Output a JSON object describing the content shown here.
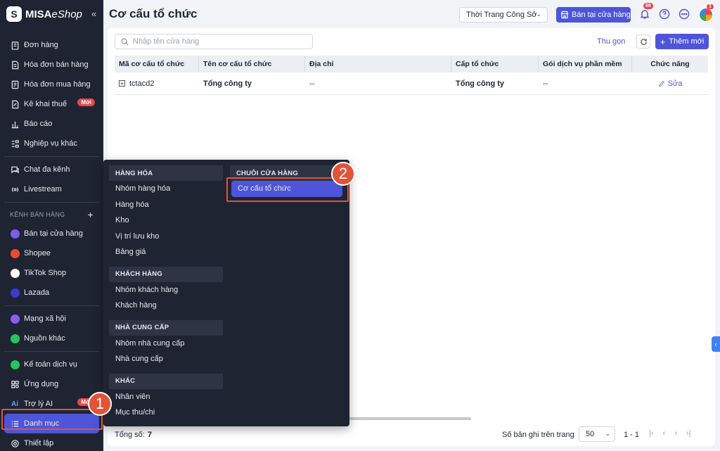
{
  "app": {
    "brand_main": "MISA",
    "brand_sub": "eShop",
    "collapse_glyph": "«"
  },
  "sidebar": {
    "items": [
      {
        "label": "Đơn hàng",
        "icon": "clipboard-icon"
      },
      {
        "label": "Hóa đơn bán hàng",
        "icon": "invoice-icon"
      },
      {
        "label": "Hóa đơn mua hàng",
        "icon": "purchase-invoice-icon"
      },
      {
        "label": "Kê khai thuế",
        "icon": "tax-icon",
        "badge": "Mới"
      },
      {
        "label": "Báo cáo",
        "icon": "chart-icon"
      },
      {
        "label": "Nghiệp vụ khác",
        "icon": "list-settings-icon"
      }
    ],
    "items2": [
      {
        "label": "Chat đa kênh",
        "icon": "chat-icon"
      },
      {
        "label": "Livestream",
        "icon": "live-icon"
      }
    ],
    "channels_title": "KÊNH BÁN HÀNG",
    "channels": [
      {
        "label": "Bán tại cửa hàng",
        "color": "#7c5cf0"
      },
      {
        "label": "Shopee",
        "color": "#ee4d2d"
      },
      {
        "label": "TikTok Shop",
        "color": "#ffffff"
      },
      {
        "label": "Lazada",
        "color": "#3b3bd1"
      }
    ],
    "items3": [
      {
        "label": "Mạng xã hội",
        "color": "#8b5cf6"
      },
      {
        "label": "Nguồn khác",
        "color": "#22c55e"
      }
    ],
    "items4": [
      {
        "label": "Kế toán dịch vụ",
        "color": "#22c55e"
      },
      {
        "label": "Ứng dụng",
        "icon": "apps-icon"
      },
      {
        "label": "Trợ lý AI",
        "icon": "ai-icon",
        "badge": "Mới"
      },
      {
        "label": "Danh mục",
        "icon": "list-icon",
        "active": true
      },
      {
        "label": "Thiết lập",
        "icon": "gear-icon"
      }
    ]
  },
  "header": {
    "title": "Cơ cấu tổ chức",
    "store": "Thời Trang Công Sở",
    "sell_button": "Bán tại cửa hàng",
    "notif_count": "69",
    "avatar_badge": "1"
  },
  "toolbar": {
    "search_placeholder": "Nhập tên cửa hàng",
    "collapse_label": "Thu gọn",
    "add_label": "Thêm mới"
  },
  "table": {
    "columns": [
      "Mã cơ cấu tổ chức",
      "Tên cơ cấu tổ chức",
      "Địa chỉ",
      "Cấp tổ chức",
      "Gói dịch vụ phần mềm",
      "Chức năng"
    ],
    "rows": [
      {
        "code": "tctacd2",
        "name": "Tổng công ty",
        "address": "--",
        "level": "Tổng công ty",
        "package": "--",
        "action": "Sửa"
      }
    ]
  },
  "footer": {
    "total_label": "Tổng số:",
    "total_value": "7",
    "per_page_label": "Số bản ghi trên trang",
    "per_page_value": "50",
    "range": "1 - 1"
  },
  "menu": {
    "left": [
      {
        "head": "HÀNG HÓA",
        "items": [
          "Nhóm hàng hóa",
          "Hàng hóa",
          "Kho",
          "Vị trí lưu kho",
          "Bảng giá"
        ]
      },
      {
        "head": "KHÁCH HÀNG",
        "items": [
          "Nhóm khách hàng",
          "Khách hàng"
        ]
      },
      {
        "head": "NHÀ CUNG CẤP",
        "items": [
          "Nhóm nhà cung cấp",
          "Nhà cung cấp"
        ]
      },
      {
        "head": "KHÁC",
        "items": [
          "Nhân viên",
          "Mục thu/chi"
        ]
      }
    ],
    "right": {
      "head": "CHUỖI CỬA HÀNG",
      "items": [
        "Cơ cấu tổ chức"
      ]
    }
  },
  "annotations": {
    "step1": "1",
    "step2": "2"
  },
  "colors": {
    "accent": "#4d55d8",
    "sidebar_bg": "#1f2433",
    "annotation": "#e35336",
    "badge": "#e5484d"
  }
}
